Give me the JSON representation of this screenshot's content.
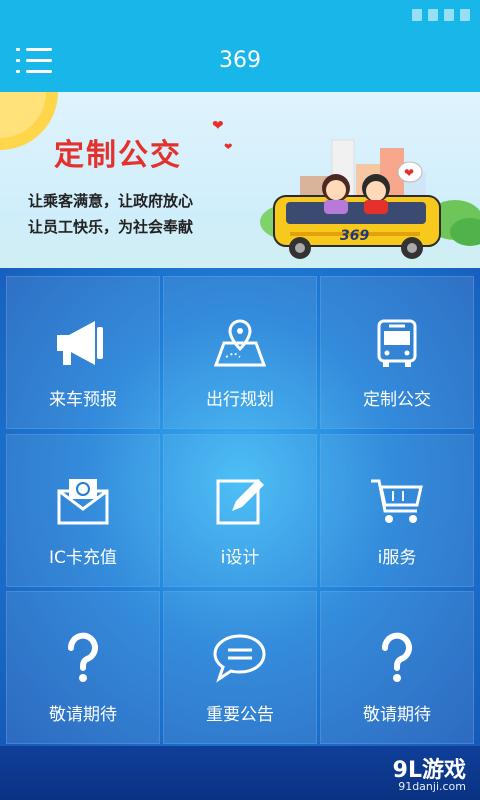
{
  "header": {
    "title": "369"
  },
  "banner": {
    "title": "定制公交",
    "line1": "让乘客满意，让政府放心",
    "line2": "让员工快乐，为社会奉献",
    "bus_number": "369"
  },
  "grid": {
    "tiles": [
      {
        "label": "来车预报",
        "icon": "megaphone-icon"
      },
      {
        "label": "出行规划",
        "icon": "map-pin-icon"
      },
      {
        "label": "定制公交",
        "icon": "bus-icon"
      },
      {
        "label": "IC卡充值",
        "icon": "card-mail-icon"
      },
      {
        "label": "i设计",
        "icon": "edit-icon"
      },
      {
        "label": "i服务",
        "icon": "cart-icon"
      },
      {
        "label": "敬请期待",
        "icon": "question-icon"
      },
      {
        "label": "重要公告",
        "icon": "chat-bubble-icon"
      },
      {
        "label": "敬请期待",
        "icon": "question-icon"
      }
    ]
  },
  "watermark": {
    "text": "9L游戏",
    "url": "91danji.com"
  },
  "colors": {
    "header": "#19b6ea",
    "accent_red": "#e5312c",
    "grid_deep": "#1659b8",
    "grid_light": "#3ab8f5"
  }
}
